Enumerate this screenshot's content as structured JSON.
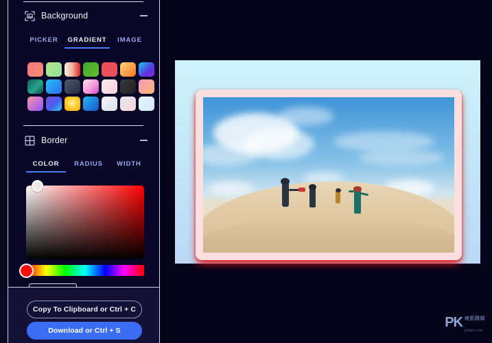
{
  "app": {
    "panel_bg": "#0a0627",
    "accent": "#3b6cf6",
    "canvas_bg_top": "#cdf3fb",
    "canvas_bg_bottom": "#b9d8f5"
  },
  "sidebar": {
    "sections": [
      {
        "id": "background",
        "title": "Background",
        "icon": "image-placeholder-icon",
        "collapse_icon": "minus-icon",
        "tabs": [
          {
            "label": "PICKER",
            "active": false
          },
          {
            "label": "GRADIENT",
            "active": true
          },
          {
            "label": "IMAGE",
            "active": false
          }
        ]
      },
      {
        "id": "border",
        "title": "Border",
        "icon": "grid-icon",
        "collapse_icon": "minus-icon",
        "tabs": [
          {
            "label": "COLOR",
            "active": true
          },
          {
            "label": "RADIUS",
            "active": false
          },
          {
            "label": "WIDTH",
            "active": false
          }
        ]
      }
    ],
    "gradient_swatches": [
      {
        "name": "salmon-pink",
        "css": "linear-gradient(135deg,#f2777f 0%,#f98d74 100%)"
      },
      {
        "name": "lime-mint",
        "css": "linear-gradient(135deg,#b6e887 0%,#8fe39e 100%)"
      },
      {
        "name": "cream-red",
        "css": "linear-gradient(90deg,#f6efe3 0%,#f0b4a0 48%,#e02424 100%)"
      },
      {
        "name": "green-grass",
        "css": "linear-gradient(135deg,#3fa32a 0%,#63c030 100%)"
      },
      {
        "name": "coral-red",
        "css": "linear-gradient(135deg,#ee4e59 0%,#e8505b 100%)"
      },
      {
        "name": "gold-orange",
        "css": "linear-gradient(135deg,#ffd97a 0%,#f47520 100%)"
      },
      {
        "name": "blue-violet",
        "css": "linear-gradient(135deg,#16c8f0 0%,#5a36e0 60%,#8a2be2 100%)"
      },
      {
        "name": "teal-deep",
        "css": "linear-gradient(135deg,#0e5e56 0%,#2aa58c 55%,#0c4a46 100%)"
      },
      {
        "name": "cyan-blue",
        "css": "linear-gradient(135deg,#23c2f5 0%,#2b6ef0 100%)"
      },
      {
        "name": "slate-navy",
        "css": "linear-gradient(135deg,#4e5a6d 0%,#232b3b 100%)"
      },
      {
        "name": "pink-magenta",
        "css": "linear-gradient(135deg,#ffe3f1 0%,#f49ad8 55%,#cf4bd0 100%)"
      },
      {
        "name": "blush-white",
        "css": "linear-gradient(135deg,#fdeef0 0%,#f7cfd8 100%)"
      },
      {
        "name": "charcoal",
        "css": "linear-gradient(135deg,#3a3a3c 0%,#1f1f21 100%)"
      },
      {
        "name": "pink-amber",
        "css": "linear-gradient(135deg,#f79bc4 0%,#f8b56d 100%)"
      },
      {
        "name": "orchid-coral",
        "css": "linear-gradient(135deg,#f09a9a 0%,#c06bdd 60%,#8b5cf0 100%)"
      },
      {
        "name": "indigo-cyan",
        "css": "linear-gradient(135deg,#7b4ce0 0%,#4b5ef0 55%,#2fd3f0 100%)"
      },
      {
        "name": "sun-yellow",
        "css": "radial-gradient(circle at 50% 45%,#fff3a8 0%,#ffcf33 45%,#f7a800 100%)"
      },
      {
        "name": "azure-blue",
        "css": "linear-gradient(135deg,#27b4f0 0%,#1558c8 100%)"
      },
      {
        "name": "pale-silver",
        "css": "linear-gradient(135deg,#f4f4f8 0%,#dfe0e8 100%)"
      },
      {
        "name": "peach-cloud",
        "css": "linear-gradient(135deg,#e6e9f5 0%,#f8d4d4 100%)"
      },
      {
        "name": "ice-blue",
        "css": "linear-gradient(135deg,#e8f6ff 0%,#cfe9fb 100%)"
      }
    ],
    "color_picker": {
      "name": "saturation-value-area",
      "selected_hue": "#ff0000",
      "handle_color": "#efe7e7",
      "hue_handle_color": "#f80f0f"
    },
    "actions": {
      "copy_label": "Copy To Clipboard or Ctrl + C",
      "download_label": "Download or Ctrl + S"
    }
  },
  "preview": {
    "name": "image-preview",
    "border_color": "#fbdfde",
    "glow_color": "#e41919",
    "photo_alt": "Children running down a sand dune under a blue sky"
  },
  "watermark": {
    "logo": "PK",
    "cn_text": "痞凱踐踏",
    "url": "pkkpk.com"
  }
}
